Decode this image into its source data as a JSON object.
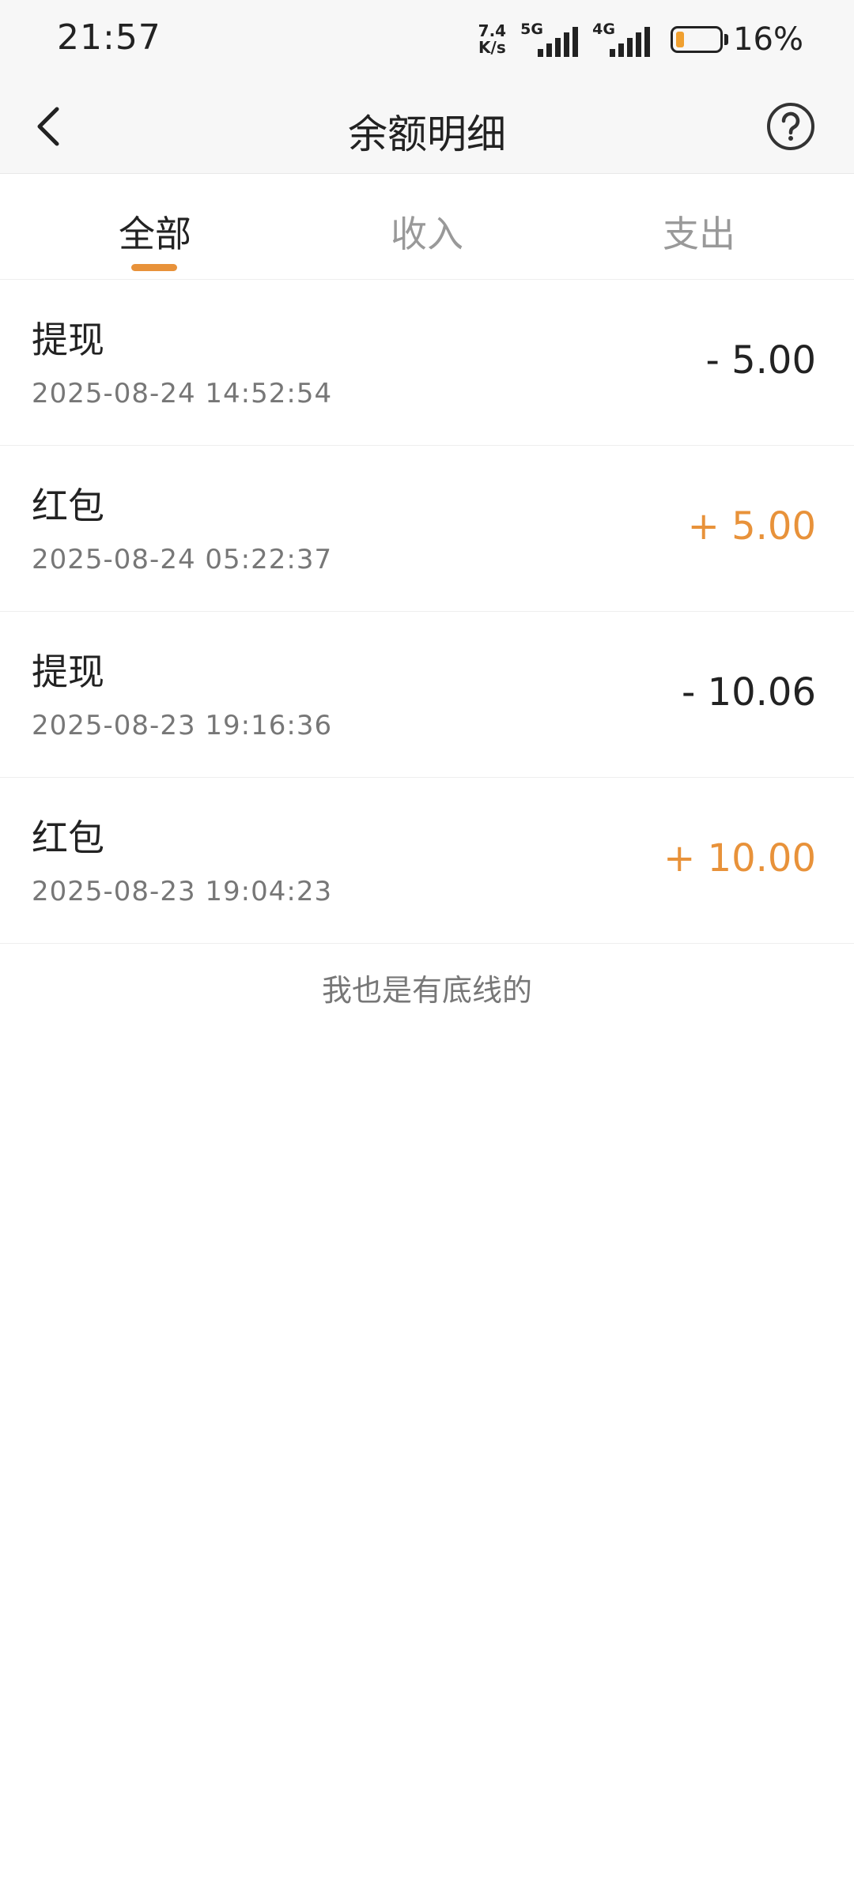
{
  "status_bar": {
    "time": "21:57",
    "net_speed_value": "7.4",
    "net_speed_unit": "K/s",
    "signal1_tag": "5G",
    "signal2_tag": "4G",
    "battery_percent_text": "16%",
    "battery_level": 0.16,
    "battery_color": "#f0a030"
  },
  "navbar": {
    "title": "余额明细",
    "back_icon": "chevron-left-icon",
    "help_icon": "question-circle-icon"
  },
  "tabs": [
    {
      "label": "全部",
      "active": true
    },
    {
      "label": "收入",
      "active": false
    },
    {
      "label": "支出",
      "active": false
    }
  ],
  "accent_color": "#e8923a",
  "transactions": [
    {
      "title": "提现",
      "time": "2025-08-24 14:52:54",
      "amount": "- 5.00",
      "type": "expense"
    },
    {
      "title": "红包",
      "time": "2025-08-24 05:22:37",
      "amount": "+ 5.00",
      "type": "income"
    },
    {
      "title": "提现",
      "time": "2025-08-23 19:16:36",
      "amount": "- 10.06",
      "type": "expense"
    },
    {
      "title": "红包",
      "time": "2025-08-23 19:04:23",
      "amount": "+ 10.00",
      "type": "income"
    }
  ],
  "footer_note": "我也是有底线的"
}
